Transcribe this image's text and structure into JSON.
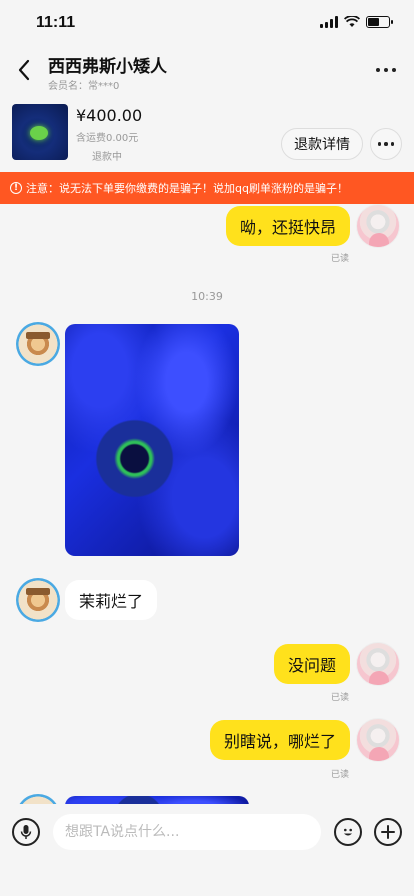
{
  "status_bar": {
    "time": "11:11"
  },
  "header": {
    "title": "西西弗斯小矮人",
    "subtitle": "会员名：常***0"
  },
  "order": {
    "price": "¥400.00",
    "shipping": "含运费0.00元",
    "status": "退款中",
    "refund_button": "退款详情"
  },
  "notice": {
    "icon": "warning-icon",
    "text": "注意：说无法下单要你缴费的是骗子！说加qq刷单涨粉的是骗子！"
  },
  "messages": {
    "m1": {
      "text": "呦，还挺快昂",
      "read": "已读"
    },
    "timestamp": "10:39",
    "m3": {
      "text": "茉莉烂了"
    },
    "m4": {
      "text": "没问题",
      "read": "已读"
    },
    "m5": {
      "text": "别瞎说，哪烂了",
      "read": "已读"
    }
  },
  "input": {
    "placeholder": "想跟TA说点什么..."
  },
  "colors": {
    "accent_yellow": "#ffe11c",
    "notice_orange": "#ff5722",
    "background": "#f5f5f5"
  }
}
